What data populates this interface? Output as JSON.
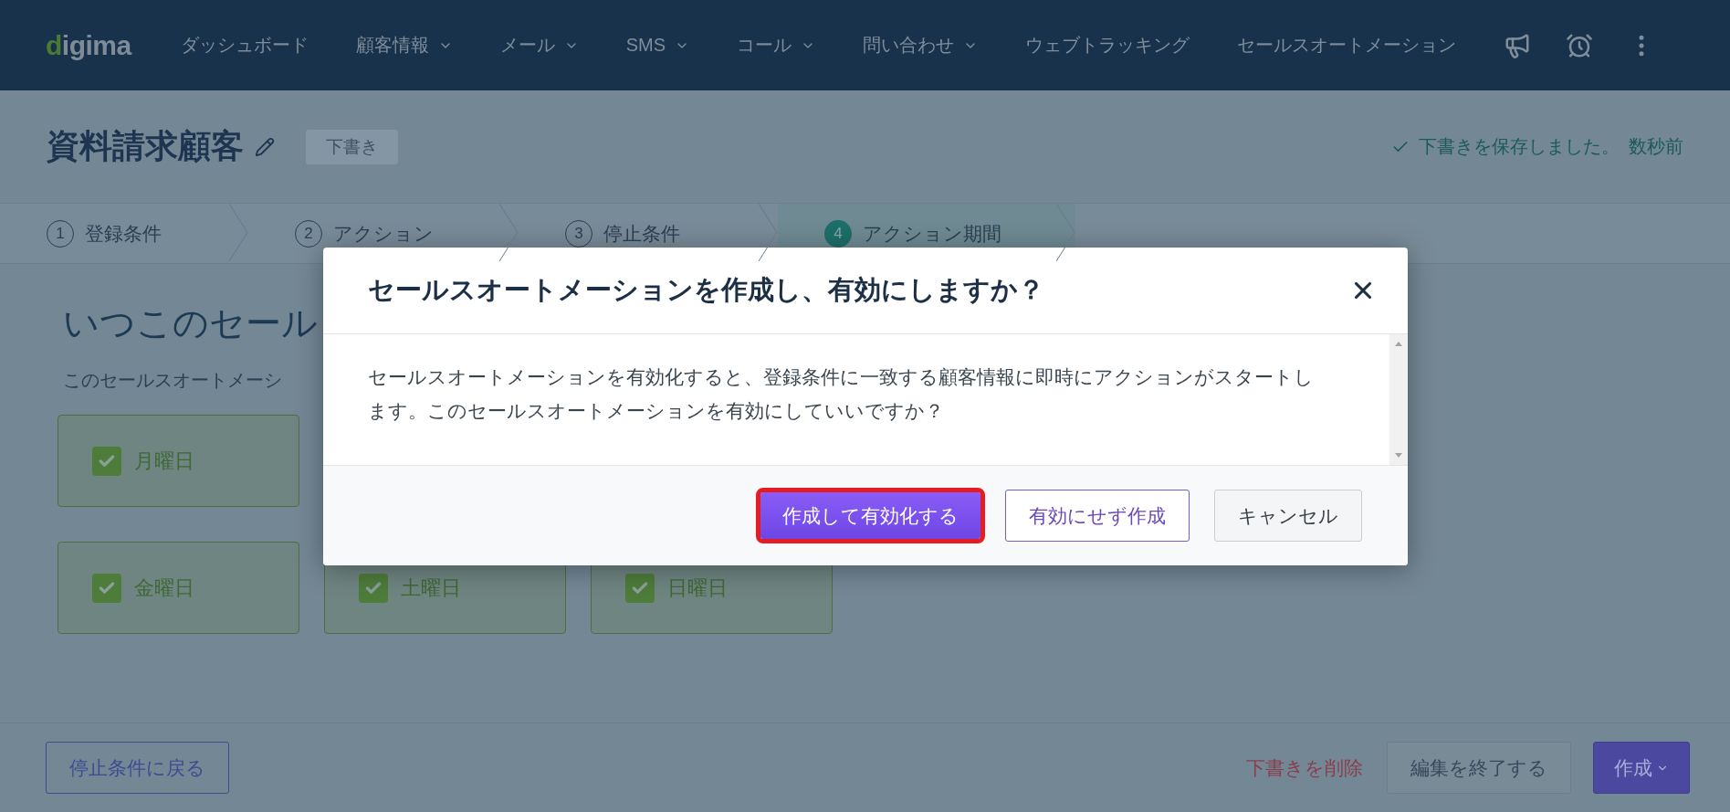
{
  "nav": {
    "logo": "digima",
    "items": [
      {
        "label": "ダッシュボード",
        "dropdown": false
      },
      {
        "label": "顧客情報",
        "dropdown": true
      },
      {
        "label": "メール",
        "dropdown": true
      },
      {
        "label": "SMS",
        "dropdown": true
      },
      {
        "label": "コール",
        "dropdown": true
      },
      {
        "label": "問い合わせ",
        "dropdown": true
      },
      {
        "label": "ウェブトラッキング",
        "dropdown": false
      },
      {
        "label": "セールスオートメーション",
        "dropdown": false
      }
    ]
  },
  "header": {
    "title": "資料請求顧客",
    "status_badge": "下書き",
    "save_status": "下書きを保存しました。",
    "save_time": "数秒前"
  },
  "steps": [
    {
      "number": "1",
      "label": "登録条件",
      "selected": false
    },
    {
      "number": "2",
      "label": "アクション",
      "selected": false
    },
    {
      "number": "3",
      "label": "停止条件",
      "selected": false
    },
    {
      "number": "4",
      "label": "アクション期間",
      "selected": true
    }
  ],
  "section": {
    "heading": "いつこのセール",
    "description": "このセールスオートメーシ",
    "day_rows": [
      {
        "days": [
          {
            "label": "月曜日",
            "checked": true
          }
        ]
      },
      {
        "days": [
          {
            "label": "金曜日",
            "checked": true
          },
          {
            "label": "土曜日",
            "checked": true
          },
          {
            "label": "日曜日",
            "checked": true
          }
        ]
      }
    ]
  },
  "footer": {
    "back_button": "停止条件に戻る",
    "delete_link": "下書きを削除",
    "exit_button": "編集を終了する",
    "create_button": "作成"
  },
  "modal": {
    "title": "セールスオートメーションを作成し、有効にしますか？",
    "body": "セールスオートメーションを有効化すると、登録条件に一致する顧客情報に即時にアクションがスタートします。このセールスオートメーションを有効にしていいですか？",
    "buttons": [
      {
        "label": "作成して有効化する",
        "kind": "primary",
        "highlighted": true
      },
      {
        "label": "有効にせず作成",
        "kind": "outline",
        "highlighted": false
      },
      {
        "label": "キャンセル",
        "kind": "default",
        "highlighted": false
      }
    ]
  }
}
